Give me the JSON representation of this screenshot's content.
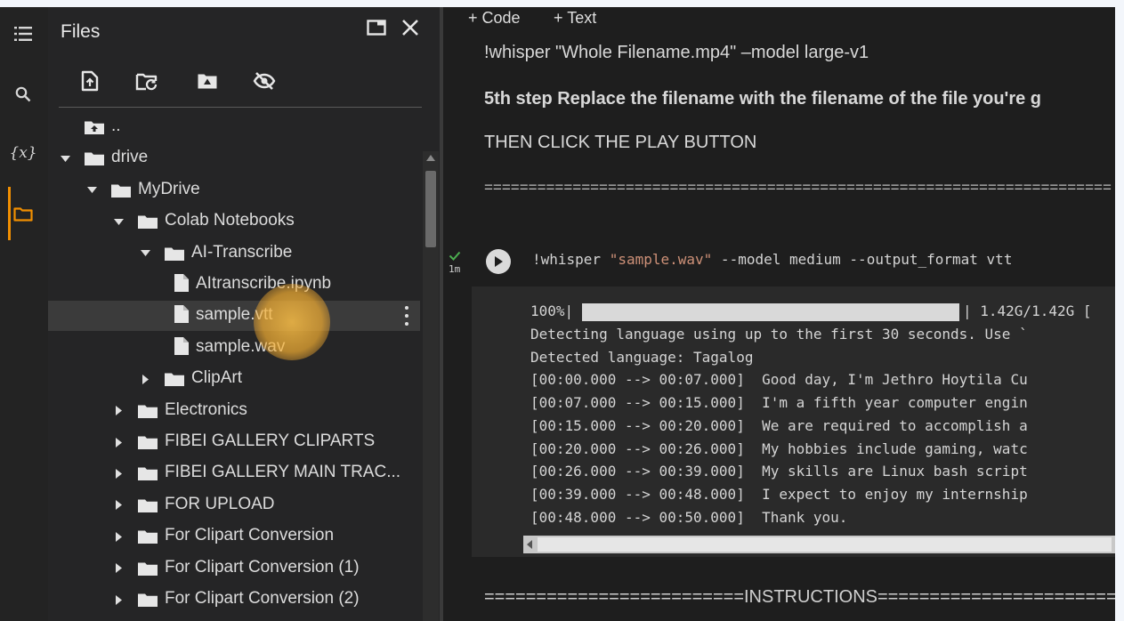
{
  "sidebar": {
    "title": "Files",
    "icons": [
      "menu-icon",
      "search-icon",
      "variables-icon",
      "folder-icon"
    ],
    "variables_label": "{x}",
    "toolbar": [
      "upload-file-icon",
      "refresh-icon",
      "mount-drive-icon",
      "hide-files-icon"
    ],
    "tree": [
      {
        "label": "..",
        "indent": 0,
        "arrow": "",
        "icon": "folder-up"
      },
      {
        "label": "drive",
        "indent": 0,
        "arrow": "down",
        "icon": "folder"
      },
      {
        "label": "MyDrive",
        "indent": 1,
        "arrow": "down",
        "icon": "folder"
      },
      {
        "label": "Colab Notebooks",
        "indent": 2,
        "arrow": "down",
        "icon": "folder"
      },
      {
        "label": "AI-Transcribe",
        "indent": 3,
        "arrow": "down",
        "icon": "folder"
      },
      {
        "label": "AItranscribe.ipynb",
        "indent": 4,
        "arrow": "",
        "icon": "file"
      },
      {
        "label": "sample.vtt",
        "indent": 4,
        "arrow": "",
        "icon": "file",
        "selected": true
      },
      {
        "label": "sample.wav",
        "indent": 4,
        "arrow": "",
        "icon": "file"
      },
      {
        "label": "ClipArt",
        "indent": 3,
        "arrow": "right",
        "icon": "folder"
      },
      {
        "label": "Electronics",
        "indent": 2,
        "arrow": "right",
        "icon": "folder"
      },
      {
        "label": "FIBEI GALLERY CLIPARTS",
        "indent": 2,
        "arrow": "right",
        "icon": "folder"
      },
      {
        "label": "FIBEI GALLERY MAIN TRAC...",
        "indent": 2,
        "arrow": "right",
        "icon": "folder"
      },
      {
        "label": "FOR UPLOAD",
        "indent": 2,
        "arrow": "right",
        "icon": "folder"
      },
      {
        "label": "For Clipart Conversion",
        "indent": 2,
        "arrow": "right",
        "icon": "folder"
      },
      {
        "label": "For Clipart Conversion (1)",
        "indent": 2,
        "arrow": "right",
        "icon": "folder"
      },
      {
        "label": "For Clipart Conversion (2)",
        "indent": 2,
        "arrow": "right",
        "icon": "folder"
      }
    ]
  },
  "notebook": {
    "add_code": "+ Code",
    "add_text": "+ Text",
    "lines": {
      "cmd_text": "!whisper \"Whole Filename.mp4\" –model large-v1",
      "step5": "5th step Replace the filename with the filename of the file you're g",
      "play": "THEN CLICK THE PLAY BUTTON",
      "rule": "=======================================================================",
      "instructions": "=========================INSTRUCTIONS================================"
    },
    "cell": {
      "status_time": "1m",
      "code_prefix": "!whisper ",
      "code_string": "\"sample.wav\"",
      "code_suffix": " --model medium --output_format vtt",
      "progress_percent": "100%|",
      "progress_right": "| 1.42G/1.42G [",
      "progress_value": 1.0,
      "output": [
        "Detecting language using up to the first 30 seconds. Use `",
        "Detected language: Tagalog",
        "[00:00.000 --> 00:07.000]  Good day, I'm Jethro Hoytila Cu",
        "[00:07.000 --> 00:15.000]  I'm a fifth year computer engin",
        "[00:15.000 --> 00:20.000]  We are required to accomplish a",
        "[00:20.000 --> 00:26.000]  My hobbies include gaming, watc",
        "[00:26.000 --> 00:39.000]  My skills are Linux bash script",
        "[00:39.000 --> 00:48.000]  I expect to enjoy my internship",
        "[00:48.000 --> 00:50.000]  Thank you."
      ]
    }
  },
  "colors": {
    "accent": "#f18f01",
    "success": "#4caf50"
  }
}
